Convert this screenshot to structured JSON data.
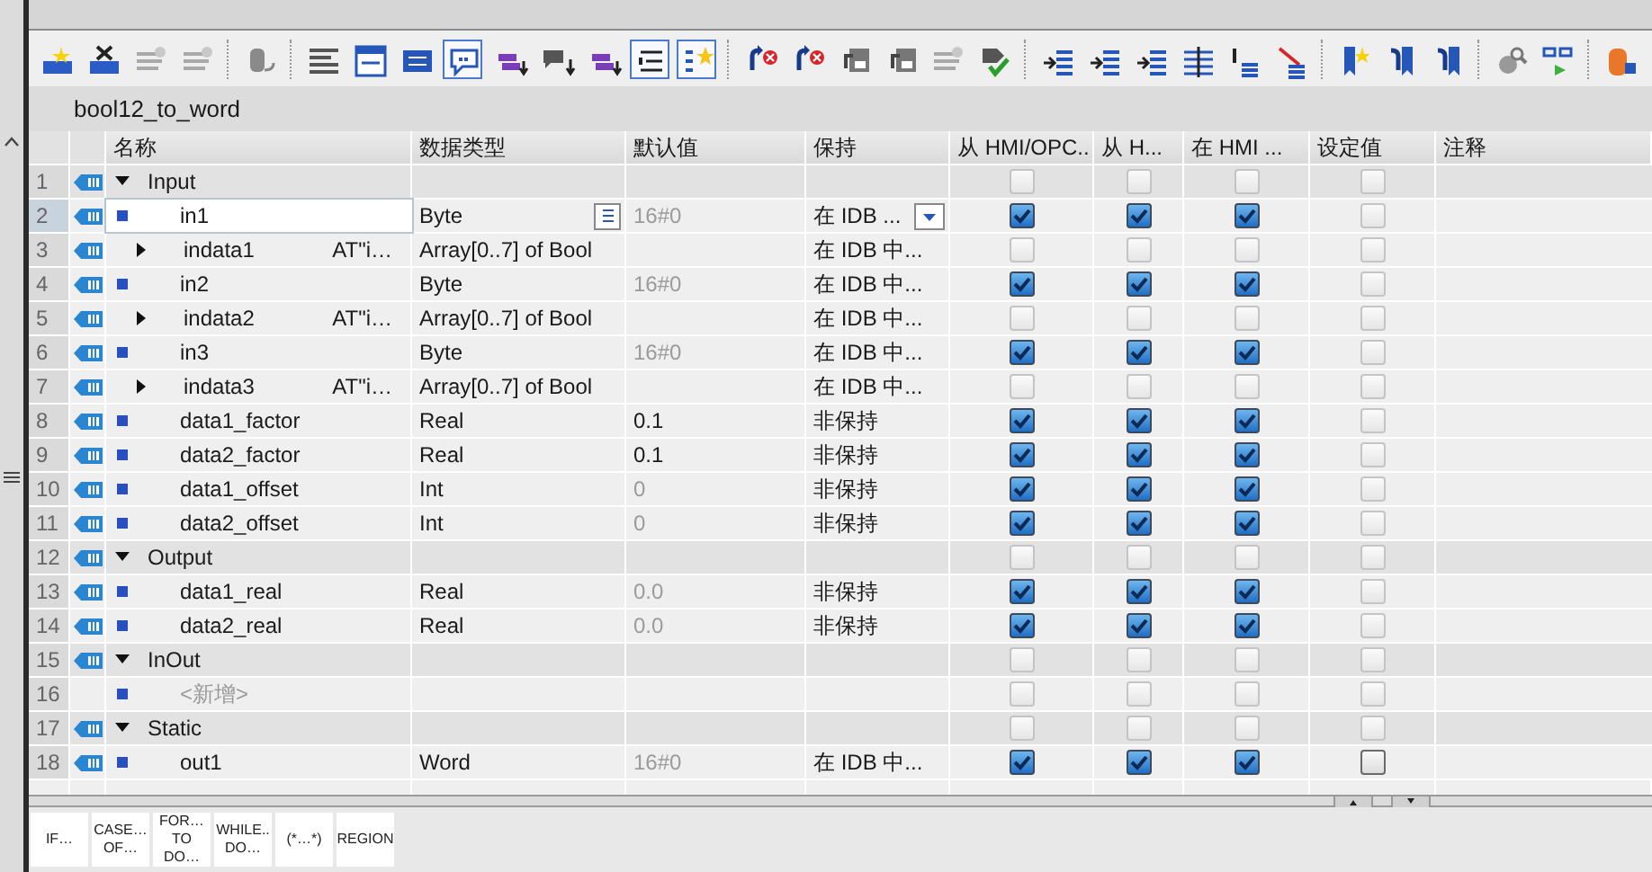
{
  "toolbar": [
    {
      "kind": "star-block",
      "selected": false
    },
    {
      "kind": "x-block",
      "selected": false
    },
    {
      "kind": "gray-lines",
      "selected": false
    },
    {
      "kind": "gray-lines",
      "selected": false
    },
    {
      "kind": "sep"
    },
    {
      "kind": "cylinder",
      "selected": false
    },
    {
      "kind": "sep"
    },
    {
      "kind": "lines",
      "selected": false
    },
    {
      "kind": "window",
      "selected": false
    },
    {
      "kind": "panel",
      "selected": false
    },
    {
      "kind": "bubble",
      "selected": true
    },
    {
      "kind": "tag-down",
      "selected": false
    },
    {
      "kind": "chat-down",
      "selected": false
    },
    {
      "kind": "tag-down",
      "selected": false
    },
    {
      "kind": "list",
      "selected": true
    },
    {
      "kind": "star-list",
      "selected": true
    },
    {
      "kind": "sep"
    },
    {
      "kind": "arrow-x",
      "selected": false
    },
    {
      "kind": "arrow-x",
      "selected": false
    },
    {
      "kind": "monitor",
      "selected": false
    },
    {
      "kind": "monitor",
      "selected": false
    },
    {
      "kind": "gray-lines",
      "selected": false
    },
    {
      "kind": "check",
      "selected": false
    },
    {
      "kind": "sep"
    },
    {
      "kind": "indent",
      "selected": false
    },
    {
      "kind": "indent",
      "selected": false
    },
    {
      "kind": "indent",
      "selected": false
    },
    {
      "kind": "multi",
      "selected": false
    },
    {
      "kind": "bars",
      "selected": false
    },
    {
      "kind": "slash",
      "selected": false
    },
    {
      "kind": "sep"
    },
    {
      "kind": "bookmark",
      "selected": false
    },
    {
      "kind": "bookmark-arrow",
      "selected": false
    },
    {
      "kind": "bookmark-arrow",
      "selected": false
    },
    {
      "kind": "sep"
    },
    {
      "kind": "magnifier",
      "selected": false
    },
    {
      "kind": "glasses",
      "selected": false
    },
    {
      "kind": "sep"
    },
    {
      "kind": "database",
      "selected": false
    }
  ],
  "block_title": "bool12_to_word",
  "columns": [
    "名称",
    "数据类型",
    "默认值",
    "保持",
    "从 HMI/OPC..",
    "从 H...",
    "在 HMI ...",
    "设定值",
    "注释"
  ],
  "rows": [
    {
      "number": "1",
      "kind": "section",
      "expanded": true,
      "name": "Input",
      "selected": false,
      "checks": [
        {
          "checked": false,
          "enabled": false
        },
        {
          "checked": false,
          "enabled": false
        },
        {
          "checked": false,
          "enabled": false
        },
        {
          "checked": false,
          "enabled": false
        }
      ]
    },
    {
      "number": "2",
      "kind": "var",
      "name": "in1",
      "type": "Byte",
      "default": "16#0",
      "default_set": false,
      "retain": "在 IDB ...",
      "selected": true,
      "checks": [
        {
          "checked": true,
          "enabled": true
        },
        {
          "checked": true,
          "enabled": true
        },
        {
          "checked": true,
          "enabled": true
        },
        {
          "checked": false,
          "enabled": false
        }
      ]
    },
    {
      "number": "3",
      "kind": "array",
      "expanded": false,
      "name": "indata1",
      "at": "AT\"i…",
      "type": "Array[0..7] of Bool",
      "retain": "在 IDB 中...",
      "selected": false,
      "checks": [
        {
          "checked": false,
          "enabled": false
        },
        {
          "checked": false,
          "enabled": false
        },
        {
          "checked": false,
          "enabled": false
        },
        {
          "checked": false,
          "enabled": false
        }
      ]
    },
    {
      "number": "4",
      "kind": "var",
      "name": "in2",
      "type": "Byte",
      "default": "16#0",
      "default_set": false,
      "retain": "在 IDB 中...",
      "selected": false,
      "checks": [
        {
          "checked": true,
          "enabled": true
        },
        {
          "checked": true,
          "enabled": true
        },
        {
          "checked": true,
          "enabled": true
        },
        {
          "checked": false,
          "enabled": false
        }
      ]
    },
    {
      "number": "5",
      "kind": "array",
      "expanded": false,
      "name": "indata2",
      "at": "AT\"i…",
      "type": "Array[0..7] of Bool",
      "retain": "在 IDB 中...",
      "selected": false,
      "checks": [
        {
          "checked": false,
          "enabled": false
        },
        {
          "checked": false,
          "enabled": false
        },
        {
          "checked": false,
          "enabled": false
        },
        {
          "checked": false,
          "enabled": false
        }
      ]
    },
    {
      "number": "6",
      "kind": "var",
      "name": "in3",
      "type": "Byte",
      "default": "16#0",
      "default_set": false,
      "retain": "在 IDB 中...",
      "selected": false,
      "checks": [
        {
          "checked": true,
          "enabled": true
        },
        {
          "checked": true,
          "enabled": true
        },
        {
          "checked": true,
          "enabled": true
        },
        {
          "checked": false,
          "enabled": false
        }
      ]
    },
    {
      "number": "7",
      "kind": "array",
      "expanded": false,
      "name": "indata3",
      "at": "AT\"i…",
      "type": "Array[0..7] of Bool",
      "retain": "在 IDB 中...",
      "selected": false,
      "checks": [
        {
          "checked": false,
          "enabled": false
        },
        {
          "checked": false,
          "enabled": false
        },
        {
          "checked": false,
          "enabled": false
        },
        {
          "checked": false,
          "enabled": false
        }
      ]
    },
    {
      "number": "8",
      "kind": "var",
      "name": "data1_factor",
      "type": "Real",
      "default": "0.1",
      "default_set": true,
      "retain": "非保持",
      "selected": false,
      "checks": [
        {
          "checked": true,
          "enabled": true
        },
        {
          "checked": true,
          "enabled": true
        },
        {
          "checked": true,
          "enabled": true
        },
        {
          "checked": false,
          "enabled": false
        }
      ]
    },
    {
      "number": "9",
      "kind": "var",
      "name": "data2_factor",
      "type": "Real",
      "default": "0.1",
      "default_set": true,
      "retain": "非保持",
      "selected": false,
      "checks": [
        {
          "checked": true,
          "enabled": true
        },
        {
          "checked": true,
          "enabled": true
        },
        {
          "checked": true,
          "enabled": true
        },
        {
          "checked": false,
          "enabled": false
        }
      ]
    },
    {
      "number": "10",
      "kind": "var",
      "name": "data1_offset",
      "type": "Int",
      "default": "0",
      "default_set": false,
      "retain": "非保持",
      "selected": false,
      "checks": [
        {
          "checked": true,
          "enabled": true
        },
        {
          "checked": true,
          "enabled": true
        },
        {
          "checked": true,
          "enabled": true
        },
        {
          "checked": false,
          "enabled": false
        }
      ]
    },
    {
      "number": "11",
      "kind": "var",
      "name": "data2_offset",
      "type": "Int",
      "default": "0",
      "default_set": false,
      "retain": "非保持",
      "selected": false,
      "checks": [
        {
          "checked": true,
          "enabled": true
        },
        {
          "checked": true,
          "enabled": true
        },
        {
          "checked": true,
          "enabled": true
        },
        {
          "checked": false,
          "enabled": false
        }
      ]
    },
    {
      "number": "12",
      "kind": "section",
      "expanded": true,
      "name": "Output",
      "selected": false,
      "checks": [
        {
          "checked": false,
          "enabled": false
        },
        {
          "checked": false,
          "enabled": false
        },
        {
          "checked": false,
          "enabled": false
        },
        {
          "checked": false,
          "enabled": false
        }
      ]
    },
    {
      "number": "13",
      "kind": "var",
      "name": "data1_real",
      "type": "Real",
      "default": "0.0",
      "default_set": false,
      "retain": "非保持",
      "selected": false,
      "checks": [
        {
          "checked": true,
          "enabled": true
        },
        {
          "checked": true,
          "enabled": true
        },
        {
          "checked": true,
          "enabled": true
        },
        {
          "checked": false,
          "enabled": false
        }
      ]
    },
    {
      "number": "14",
      "kind": "var",
      "name": "data2_real",
      "type": "Real",
      "default": "0.0",
      "default_set": false,
      "retain": "非保持",
      "selected": false,
      "checks": [
        {
          "checked": true,
          "enabled": true
        },
        {
          "checked": true,
          "enabled": true
        },
        {
          "checked": true,
          "enabled": true
        },
        {
          "checked": false,
          "enabled": false
        }
      ]
    },
    {
      "number": "15",
      "kind": "section",
      "expanded": true,
      "name": "InOut",
      "selected": false,
      "checks": [
        {
          "checked": false,
          "enabled": false
        },
        {
          "checked": false,
          "enabled": false
        },
        {
          "checked": false,
          "enabled": false
        },
        {
          "checked": false,
          "enabled": false
        }
      ]
    },
    {
      "number": "16",
      "kind": "add",
      "name": "<新增>",
      "selected": false,
      "checks": [
        {
          "checked": false,
          "enabled": false
        },
        {
          "checked": false,
          "enabled": false
        },
        {
          "checked": false,
          "enabled": false
        },
        {
          "checked": false,
          "enabled": false
        }
      ]
    },
    {
      "number": "17",
      "kind": "section",
      "expanded": true,
      "name": "Static",
      "selected": false,
      "checks": [
        {
          "checked": false,
          "enabled": false
        },
        {
          "checked": false,
          "enabled": false
        },
        {
          "checked": false,
          "enabled": false
        },
        {
          "checked": false,
          "enabled": false
        }
      ]
    },
    {
      "number": "18",
      "kind": "var",
      "name": "out1",
      "type": "Word",
      "default": "16#0",
      "default_set": false,
      "retain": "在 IDB 中...",
      "selected": false,
      "checks": [
        {
          "checked": true,
          "enabled": true
        },
        {
          "checked": true,
          "enabled": true
        },
        {
          "checked": true,
          "enabled": true
        },
        {
          "checked": false,
          "enabled": true
        }
      ]
    }
  ],
  "snippets": [
    [
      "IF…"
    ],
    [
      "CASE…",
      "OF…"
    ],
    [
      "FOR…",
      "TO DO…"
    ],
    [
      "WHILE..",
      "DO…"
    ],
    [
      "(*…*)"
    ],
    [
      "REGION"
    ]
  ]
}
